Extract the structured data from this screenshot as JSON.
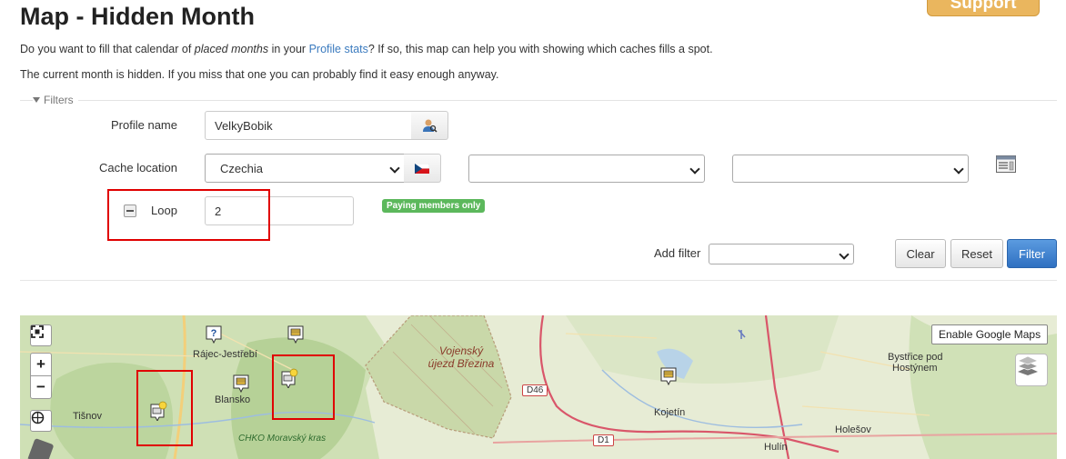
{
  "page": {
    "title": "Map - Hidden Month",
    "support_label": "Support",
    "intro1": {
      "before": "Do you want to fill that calendar of ",
      "italic": "placed months",
      "middle": " in your ",
      "link": "Profile stats",
      "after": "? If so, this map can help you with showing which caches fills a spot."
    },
    "intro2": "The current month is hidden. If you miss that one you can probably find it easy enough anyway."
  },
  "filters": {
    "legend": "Filters",
    "profile_label": "Profile name",
    "profile_value": "VelkyBobik",
    "location_label": "Cache location",
    "country_value": "Czechia",
    "region_value": "",
    "district_value": "",
    "loop_label": "Loop",
    "loop_value": "2",
    "paying_badge": "Paying members only",
    "add_filter_label": "Add filter",
    "add_filter_value": "",
    "clear_label": "Clear",
    "reset_label": "Reset",
    "filter_label": "Filter"
  },
  "icons": {
    "user_search": "user-search-icon",
    "flag": "czech-flag-icon",
    "list": "list-view-icon",
    "checkbox": "minus-checkbox-icon",
    "fullscreen": "fullscreen-icon",
    "locate": "locate-icon",
    "layers": "layers-icon",
    "cache": "cache-icon"
  },
  "map": {
    "zoom_in": "+",
    "zoom_out": "−",
    "google_maps_label": "Enable Google Maps",
    "places": {
      "rajec": "Rájec-Jestřebí",
      "blansko": "Blansko",
      "tisnov": "Tišnov",
      "chko": "CHKO Moravský kras",
      "vojensky_1": "Vojenský",
      "vojensky_2": "újezd Březina",
      "kojetin": "Kojetín",
      "bystrice_1": "Bystřice pod",
      "bystrice_2": "Hostýnem",
      "holesov": "Holešov",
      "hulin": "Hulín"
    },
    "roads": {
      "d46": "D46",
      "d1": "D1"
    }
  },
  "colors": {
    "highlight_box": "#e00000",
    "primary_button": "#3579c7",
    "badge": "#5cb85c",
    "link": "#3b7bbf"
  }
}
